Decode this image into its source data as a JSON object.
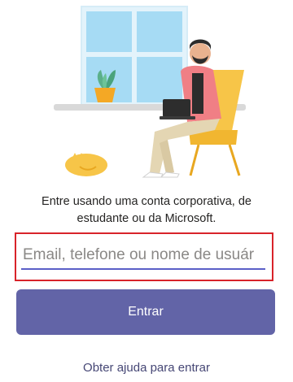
{
  "signin": {
    "prompt": "Entre usando uma conta corporativa, de estudante ou da Microsoft.",
    "input_placeholder": "Email, telefone ou nome de usuár",
    "submit_label": "Entrar",
    "help_link": "Obter ajuda para entrar"
  },
  "colors": {
    "primary": "#6264a7",
    "highlight_border": "#d8232a",
    "link": "#464775"
  }
}
